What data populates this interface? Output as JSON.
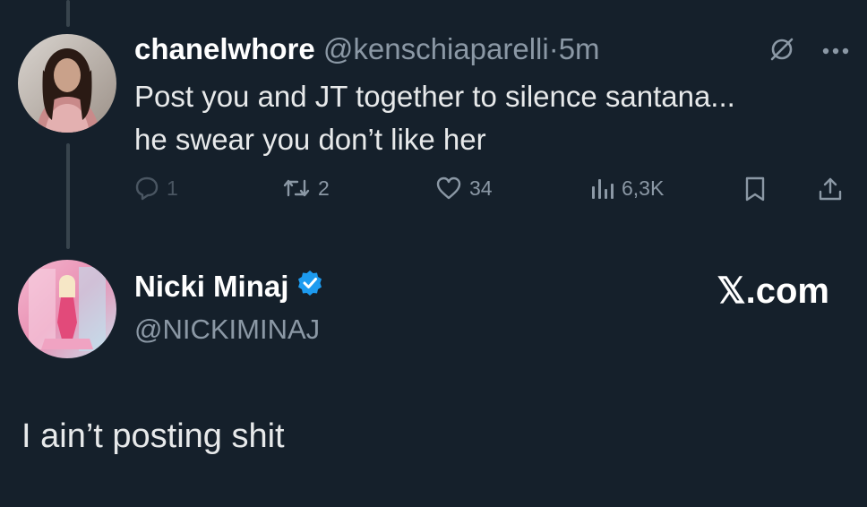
{
  "tweet1": {
    "display_name": "chanelwhore",
    "handle": "@kenschiaparelli",
    "separator": "·",
    "time": "5m",
    "lines": [
      "Post you and JT together to silence santana...",
      "he swear you don’t like her"
    ],
    "stats": {
      "replies": "1",
      "reposts": "2",
      "likes": "34",
      "views": "6,3K"
    },
    "icons": [
      "grok-icon",
      "more-icon",
      "reply-icon",
      "repost-icon",
      "like-icon",
      "views-icon",
      "bookmark-icon",
      "share-icon"
    ]
  },
  "tweet2": {
    "display_name": "Nicki Minaj",
    "handle": "@NICKIMINAJ",
    "verified": true,
    "watermark": "𝕏.com",
    "text": "I ain’t posting shit"
  },
  "colors": {
    "background": "#15202b",
    "muted": "#8b98a5",
    "verified": "#1d9bf0",
    "thread_line": "#38444d"
  }
}
